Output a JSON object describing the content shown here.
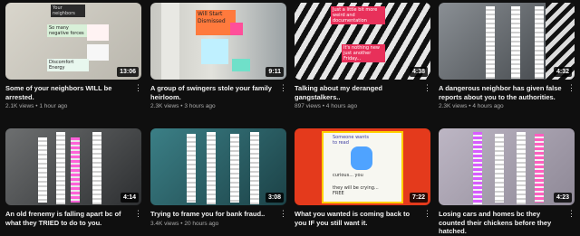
{
  "videos": [
    {
      "duration": "13:06",
      "title": "Some of your neighbors WILL be arrested.",
      "views": "2.1K views",
      "age": "1 hour ago",
      "thumb_texts": [
        "Your neighbors",
        "So many negative forces",
        "Discomfort Energy"
      ]
    },
    {
      "duration": "9:11",
      "title": "A group of swingers stole your family heirloom.",
      "views": "2.3K views",
      "age": "3 hours ago",
      "thumb_texts": [
        "Will Start Dismissed"
      ]
    },
    {
      "duration": "4:38",
      "title": "Talking about my deranged gangstalkers..",
      "views": "897 views",
      "age": "4 hours ago",
      "thumb_texts": [
        "Just a little bit more weird and documentation",
        "It's nothing new just another Friday..."
      ]
    },
    {
      "duration": "4:32",
      "title": "A dangerous neighbor has given false reports about you to the authorities.",
      "views": "2.3K views",
      "age": "4 hours ago",
      "thumb_texts": []
    },
    {
      "duration": "4:14",
      "title": "An old frenemy is falling apart bc of what they TRIED to do to you.",
      "views": "",
      "age": "",
      "thumb_texts": []
    },
    {
      "duration": "3:08",
      "title": "Trying to frame you for bank fraud..",
      "views": "3.4K views",
      "age": "20 hours ago",
      "thumb_texts": []
    },
    {
      "duration": "7:22",
      "title": "What you wanted is coming back to you IF you still want it.",
      "views": "",
      "age": "",
      "thumb_texts": [
        "Someone wants to read",
        "curious... you",
        "they will be crying... FREE"
      ]
    },
    {
      "duration": "4:23",
      "title": "Losing cars and homes bc they counted their chickens before they hatched.",
      "views": "",
      "age": "",
      "thumb_texts": []
    }
  ],
  "meta_separator": " • ",
  "more_icon": "⋮"
}
